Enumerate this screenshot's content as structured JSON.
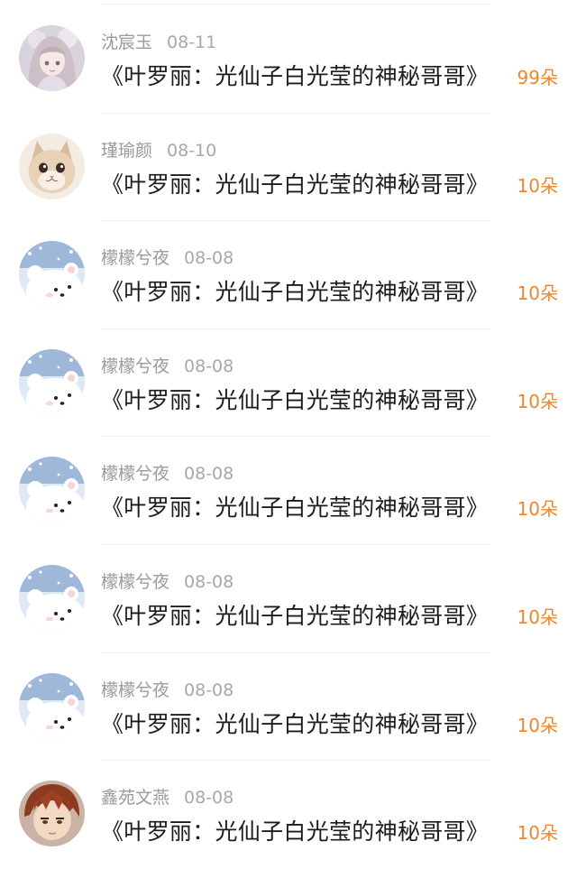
{
  "rows": [
    {
      "user": "沈宸玉",
      "date": "08-11",
      "title": "《叶罗丽：光仙子白光莹的神秘哥哥》",
      "amount": "99朵",
      "avatar": "anime-girl-avatar"
    },
    {
      "user": "瑾瑜颜",
      "date": "08-10",
      "title": "《叶罗丽：光仙子白光莹的神秘哥哥》",
      "amount": "10朵",
      "avatar": "cat-avatar"
    },
    {
      "user": "檬檬兮夜",
      "date": "08-08",
      "title": "《叶罗丽：光仙子白光莹的神秘哥哥》",
      "amount": "10朵",
      "avatar": "polar-bear-avatar"
    },
    {
      "user": "檬檬兮夜",
      "date": "08-08",
      "title": "《叶罗丽：光仙子白光莹的神秘哥哥》",
      "amount": "10朵",
      "avatar": "polar-bear-avatar"
    },
    {
      "user": "檬檬兮夜",
      "date": "08-08",
      "title": "《叶罗丽：光仙子白光莹的神秘哥哥》",
      "amount": "10朵",
      "avatar": "polar-bear-avatar"
    },
    {
      "user": "檬檬兮夜",
      "date": "08-08",
      "title": "《叶罗丽：光仙子白光莹的神秘哥哥》",
      "amount": "10朵",
      "avatar": "polar-bear-avatar"
    },
    {
      "user": "檬檬兮夜",
      "date": "08-08",
      "title": "《叶罗丽：光仙子白光莹的神秘哥哥》",
      "amount": "10朵",
      "avatar": "polar-bear-avatar"
    },
    {
      "user": "鑫苑文燕",
      "date": "08-08",
      "title": "《叶罗丽：光仙子白光莹的神秘哥哥》",
      "amount": "10朵",
      "avatar": "anime-boy-avatar"
    }
  ],
  "colors": {
    "amount": "#f2852c",
    "meta": "#9a9a9a",
    "title": "#1c1c1c",
    "divider": "#efefef"
  }
}
